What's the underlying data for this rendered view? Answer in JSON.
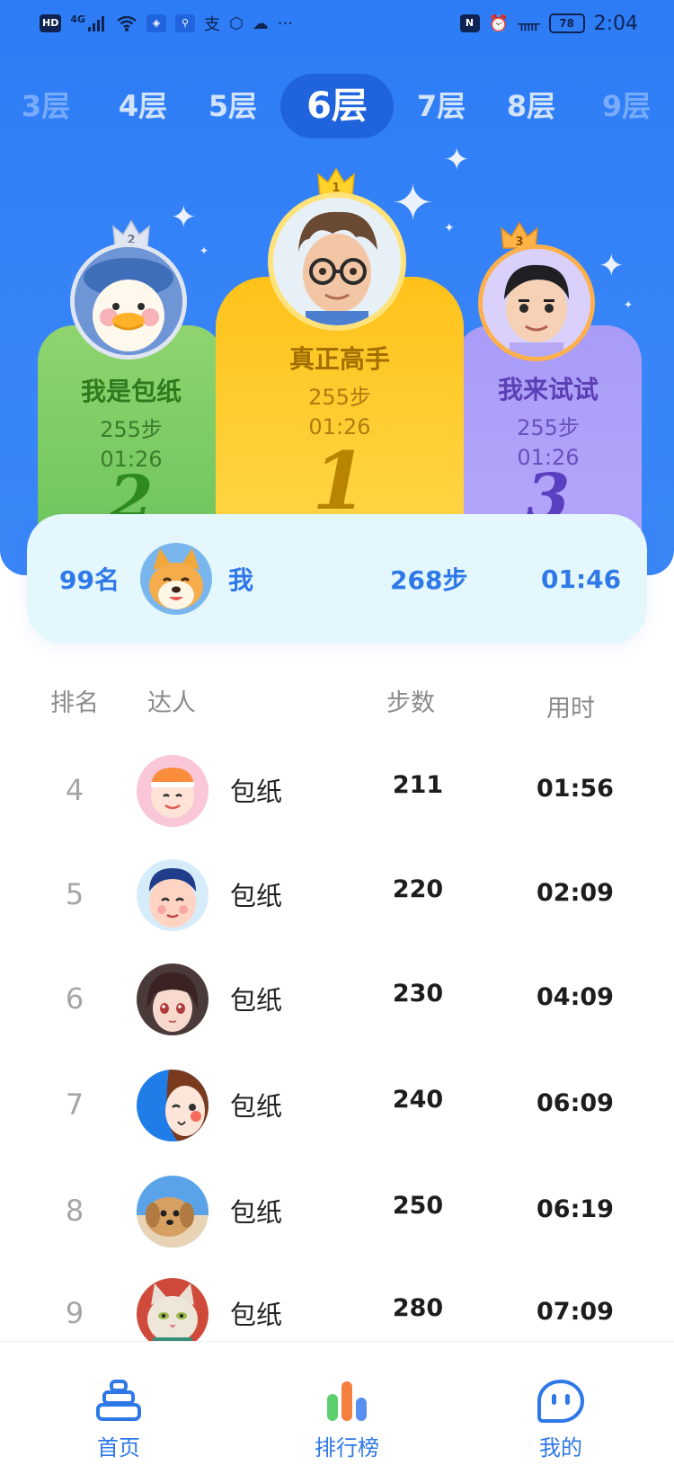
{
  "status_bar": {
    "left_icons": [
      "HD",
      "4G",
      "signal-icon",
      "wifi-icon",
      "bulb-icon",
      "search-app-icon",
      "alipay-icon",
      "shield-icon",
      "cloud-icon",
      "more-icon"
    ],
    "hd_label": "HD",
    "network_label": "4G",
    "more_label": "···",
    "right_icons": [
      "nfc-icon",
      "alarm-icon",
      "bluetooth-icon",
      "battery-icon"
    ],
    "battery": "78",
    "time": "2:04"
  },
  "floor_tabs": [
    {
      "label": "3层",
      "state": "faded"
    },
    {
      "label": "4层",
      "state": "normal"
    },
    {
      "label": "5层",
      "state": "normal"
    },
    {
      "label": "6层",
      "state": "active"
    },
    {
      "label": "7层",
      "state": "normal"
    },
    {
      "label": "8层",
      "state": "normal"
    },
    {
      "label": "9层",
      "state": "faded"
    }
  ],
  "podium": {
    "first": {
      "rank_badge": "1",
      "name": "真正高手",
      "steps": "255步",
      "time": "01:26",
      "big_rank": "1",
      "avatar": "glasses-boy-avatar"
    },
    "second": {
      "rank_badge": "2",
      "name": "我是包纸",
      "steps": "255步",
      "time": "01:26",
      "big_rank": "2",
      "avatar": "duck-avatar"
    },
    "third": {
      "rank_badge": "3",
      "name": "我来试试",
      "steps": "255步",
      "time": "01:26",
      "big_rank": "3",
      "avatar": "cartoon-boy-avatar"
    }
  },
  "me": {
    "rank": "99名",
    "name": "我",
    "steps": "268步",
    "time": "01:46",
    "avatar": "corgi-avatar"
  },
  "table": {
    "headers": {
      "rank": "排名",
      "user": "达人",
      "steps": "步数",
      "time": "用时"
    },
    "rows": [
      {
        "rank": "4",
        "name": "包纸",
        "steps": "211",
        "time": "01:56",
        "avatar": "cap-kid-avatar"
      },
      {
        "rank": "5",
        "name": "包纸",
        "steps": "220",
        "time": "02:09",
        "avatar": "man-avatar"
      },
      {
        "rank": "6",
        "name": "包纸",
        "steps": "230",
        "time": "04:09",
        "avatar": "anime-girl-avatar"
      },
      {
        "rank": "7",
        "name": "包纸",
        "steps": "240",
        "time": "06:09",
        "avatar": "cartoon-girl-avatar"
      },
      {
        "rank": "8",
        "name": "包纸",
        "steps": "250",
        "time": "06:19",
        "avatar": "puppy-avatar"
      },
      {
        "rank": "9",
        "name": "包纸",
        "steps": "280",
        "time": "07:09",
        "avatar": "cat-avatar"
      }
    ]
  },
  "bottom_nav": [
    {
      "label": "首页",
      "icon": "home-tower-icon"
    },
    {
      "label": "排行榜",
      "icon": "bar-chart-icon"
    },
    {
      "label": "我的",
      "icon": "profile-face-icon"
    }
  ],
  "colors": {
    "primary_blue": "#2d7cf6",
    "accent_text": "#2f78e8",
    "gold": "#ffc21a",
    "green": "#6bc35a",
    "purple": "#a99cf7"
  }
}
